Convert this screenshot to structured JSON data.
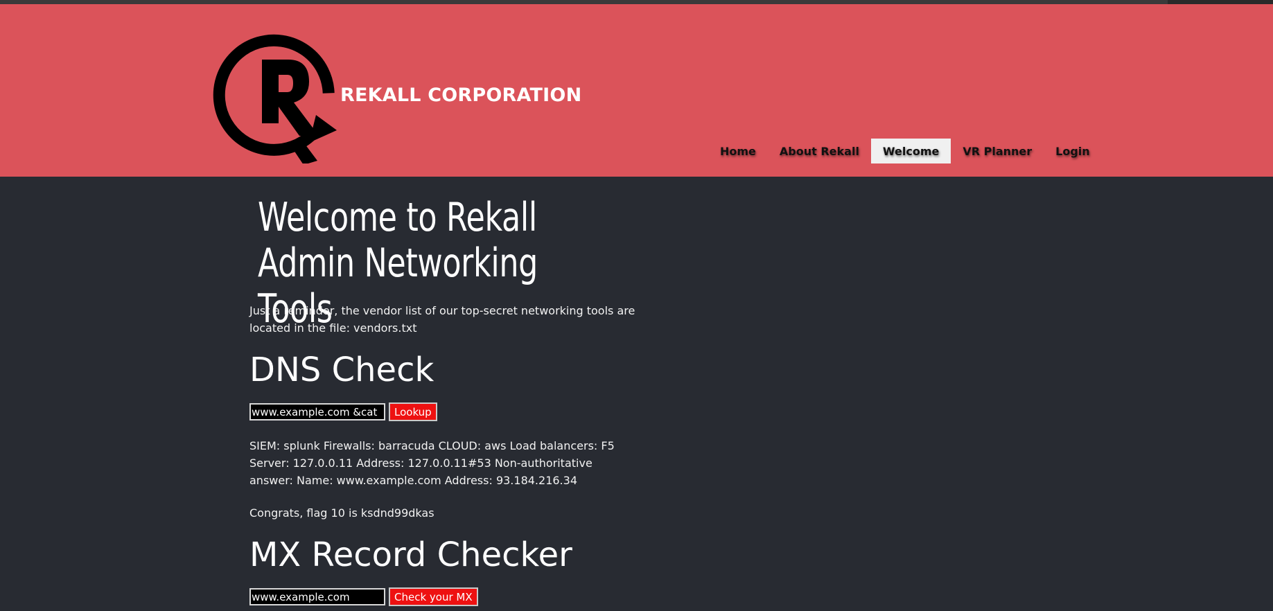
{
  "header": {
    "brand": "REKALL CORPORATION",
    "nav": [
      {
        "label": "Home"
      },
      {
        "label": "About Rekall"
      },
      {
        "label": "Welcome",
        "active": true
      },
      {
        "label": "VR Planner"
      },
      {
        "label": "Login"
      }
    ]
  },
  "main": {
    "title": "Welcome to Rekall Admin Networking Tools",
    "reminder": "Just a reminder, the vendor list of our top-secret networking tools are located in the file: vendors.txt",
    "dns": {
      "heading": "DNS Check",
      "input_value": "www.example.com &cat",
      "button_label": "Lookup",
      "result": "SIEM: splunk Firewalls: barracuda CLOUD: aws Load balancers: F5 Server: 127.0.0.11 Address: 127.0.0.11#53 Non-authoritative answer: Name: www.example.com Address: 93.184.216.34",
      "flag_text": "Congrats, flag 10 is ksdnd99dkas"
    },
    "mx": {
      "heading": "MX Record Checker",
      "input_value": "www.example.com",
      "button_label": "Check your MX"
    }
  },
  "colors": {
    "header_bg": "#db535a",
    "page_bg": "#282b32",
    "button_red": "#ee1111",
    "active_nav_bg": "#f0f0f0"
  },
  "icons": {
    "logo": "rekall-r-logo"
  }
}
